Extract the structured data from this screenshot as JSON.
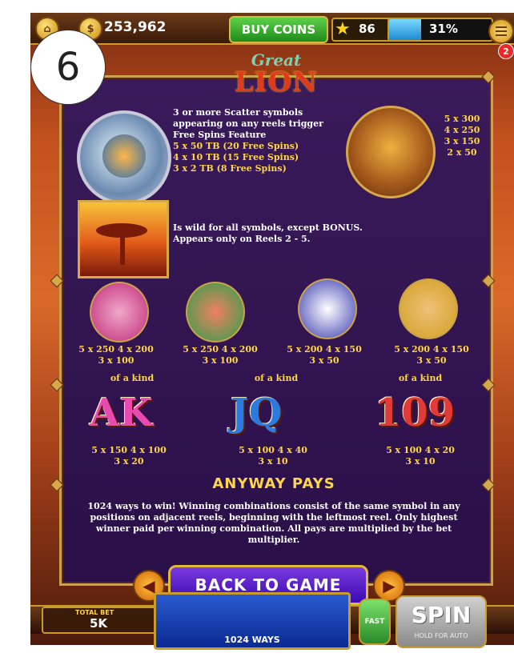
{
  "page_number": "6",
  "topbar": {
    "coins": "253,962",
    "buy_coins": "BUY COINS",
    "level": "86",
    "xp_percent": "31%",
    "xp_fraction": 0.31,
    "notification_count": "2"
  },
  "logo": {
    "line1": "Great",
    "line2": "LION"
  },
  "scatter": {
    "line1": "3 or more Scatter symbols",
    "line2": "appearing on any reels trigger",
    "line3": "Free Spins Feature",
    "pay1": "5 x 50 TB (20 Free Spins)",
    "pay2": "4 x 10 TB (15 Free Spins)",
    "pay3": "3 x 2 TB (8 Free Spins)"
  },
  "lion_pays": [
    "5 x 300",
    "4 x 250",
    "3 x 150",
    "2 x 50"
  ],
  "wild": {
    "line1": "Is wild for all symbols, except BONUS.",
    "line2": "Appears only on Reels 2 - 5."
  },
  "animals": [
    {
      "line1": "5 x 250  4 x 200",
      "line2": "3 x 100"
    },
    {
      "line1": "5 x 250  4 x 200",
      "line2": "3 x 100"
    },
    {
      "line1": "5 x 200  4 x 150",
      "line2": "3 x 50"
    },
    {
      "line1": "5 x 200  4 x 150",
      "line2": "3 x 50"
    }
  ],
  "of_a_kind": "of a kind",
  "letters": [
    {
      "symbols": "AK",
      "line1": "5 x 150  4 x 100",
      "line2": "3 x 20"
    },
    {
      "symbols": "JQ",
      "line1": "5 x 100  4 x 40",
      "line2": "3 x 10"
    },
    {
      "symbols": "109",
      "line1": "5 x 100  4 x 20",
      "line2": "3 x 10"
    }
  ],
  "anyway": {
    "title": "ANYWAY PAYS",
    "text": "1024 ways to win! Winning combinations consist of the same symbol in any positions on adjacent reels, beginning with the leftmost reel. Only highest winner paid per winning combination. All pays are multiplied by the bet multiplier."
  },
  "nav": {
    "back_to_game": "BACK TO GAME"
  },
  "bottom": {
    "total_bet_label": "TOTAL BET",
    "total_bet_value": "5K",
    "ways": "1024 WAYS",
    "fast": "FAST",
    "spin": "SPIN",
    "spin_sub": "HOLD FOR AUTO"
  }
}
